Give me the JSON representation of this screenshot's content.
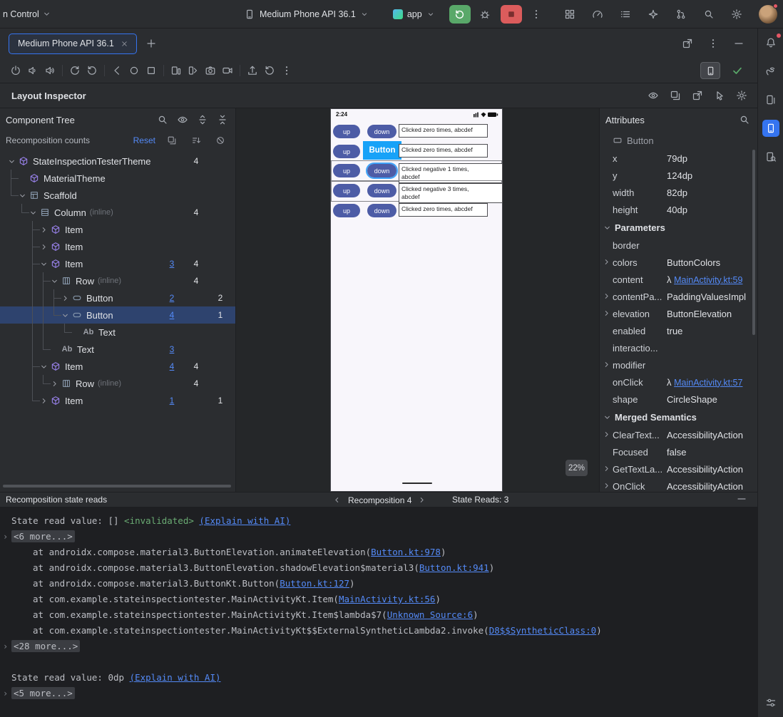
{
  "colors": {
    "accent": "#3574f0",
    "link": "#548af7",
    "selection": "#2e436e",
    "run_green": "#59a869",
    "stop_red": "#db5c5c",
    "device_button": "#4d5ca6",
    "overlay_blue": "#18a2f8",
    "invalidated_green": "#6aab73",
    "compose_node": "#9d85f2"
  },
  "icons": {
    "search-icon": "magnifier",
    "settings-icon": "gear",
    "notifications-icon": "bell",
    "visibility-icon": "eye",
    "close-icon": "x",
    "new-tab-icon": "plus",
    "more-icon": "kebab-dots",
    "rerun-icon": "circular-arrow",
    "debug-icon": "bug",
    "stop-icon": "red-square",
    "status-check-icon": "green-checkmark",
    "chevron-down-icon": "chevron-down",
    "chevron-right-icon": "chevron-right"
  },
  "titlebar": {
    "project_menu": "n Control",
    "device_selector": "Medium Phone API 36.1",
    "run_config": "app"
  },
  "tabbar": {
    "active_tab": "Medium Phone API 36.1"
  },
  "inspector": {
    "title": "Layout Inspector",
    "zoom": "22%"
  },
  "component_tree": {
    "title": "Component Tree",
    "counts_label": "Recomposition counts",
    "reset_label": "Reset",
    "nodes": [
      {
        "cells": "",
        "chev": "down",
        "icon": "compose",
        "label": "StateInspectionTesterTheme",
        "c": [
          "",
          "4",
          ""
        ]
      },
      {
        "cells": "t",
        "chev": "",
        "icon": "compose",
        "label": "MaterialTheme",
        "c": [
          "",
          "",
          ""
        ]
      },
      {
        "cells": "e",
        "chev": "down",
        "icon": "scaffold",
        "label": "Scaffold",
        "c": [
          "",
          "",
          ""
        ]
      },
      {
        "cells": "be",
        "chev": "down",
        "icon": "column",
        "label": "Column",
        "suffix": "(inline)",
        "c": [
          "",
          "4",
          ""
        ]
      },
      {
        "cells": "bbt",
        "chev": "right",
        "icon": "compose",
        "label": "Item",
        "c": [
          "",
          "",
          ""
        ]
      },
      {
        "cells": "bbt",
        "chev": "right",
        "icon": "compose",
        "label": "Item",
        "c": [
          "",
          "",
          ""
        ]
      },
      {
        "cells": "bbt",
        "chev": "down",
        "icon": "compose",
        "label": "Item",
        "c": [
          "3",
          "4",
          ""
        ]
      },
      {
        "cells": "bblt",
        "chev": "down",
        "icon": "row",
        "label": "Row",
        "suffix": "(inline)",
        "c": [
          "",
          "4",
          ""
        ]
      },
      {
        "cells": "bbllt",
        "chev": "right",
        "icon": "button",
        "label": "Button",
        "c": [
          "2",
          "",
          "2"
        ]
      },
      {
        "cells": "bblle",
        "chev": "down",
        "icon": "button",
        "label": "Button",
        "c": [
          "4",
          "",
          "1"
        ],
        "selected": true
      },
      {
        "cells": "bbllbe",
        "chev": "",
        "icon": "text",
        "label": "Text",
        "c": [
          "",
          "",
          ""
        ]
      },
      {
        "cells": "bble",
        "chev": "",
        "icon": "text",
        "label": "Text",
        "c": [
          "3",
          "",
          ""
        ]
      },
      {
        "cells": "bbt",
        "chev": "down",
        "icon": "compose",
        "label": "Item",
        "c": [
          "4",
          "4",
          ""
        ]
      },
      {
        "cells": "bble",
        "chev": "right",
        "icon": "row",
        "label": "Row",
        "suffix": "(inline)",
        "c": [
          "",
          "4",
          ""
        ]
      },
      {
        "cells": "bbe",
        "chev": "right",
        "icon": "compose",
        "label": "Item",
        "c": [
          "1",
          "",
          "1"
        ]
      }
    ]
  },
  "device": {
    "time": "2:24",
    "selection_label": "Button",
    "up_label": "up",
    "down_label": "down",
    "rows": [
      {
        "line1": "Clicked zero times, abcdef",
        "line2": "",
        "variant": "normal"
      },
      {
        "line1": "Clicked zero times, abcdef",
        "line2": "",
        "variant": "label"
      },
      {
        "line1": "Clicked negative 1 times,",
        "line2": "abcdef",
        "variant": "selected"
      },
      {
        "line1": "Clicked negative 3 times,",
        "line2": "abcdef",
        "variant": "normal"
      },
      {
        "line1": "Clicked zero times, abcdef",
        "line2": "",
        "variant": "normal"
      }
    ]
  },
  "attributes": {
    "title": "Attributes",
    "node_type": "Button",
    "geometry": [
      {
        "label": "x",
        "value": "79dp"
      },
      {
        "label": "y",
        "value": "124dp"
      },
      {
        "label": "width",
        "value": "82dp"
      },
      {
        "label": "height",
        "value": "40dp"
      }
    ],
    "sections": [
      {
        "title": "Parameters",
        "rows": [
          {
            "label": "border",
            "value": ""
          },
          {
            "label": "colors",
            "value": "ButtonColors",
            "expand": true
          },
          {
            "label": "content",
            "value": "MainActivity.kt:59",
            "lambda": true
          },
          {
            "label": "contentPa...",
            "value": "PaddingValuesImpl",
            "expand": true
          },
          {
            "label": "elevation",
            "value": "ButtonElevation",
            "expand": true
          },
          {
            "label": "enabled",
            "value": "true"
          },
          {
            "label": "interactio...",
            "value": ""
          },
          {
            "label": "modifier",
            "value": "",
            "expand": true
          },
          {
            "label": "onClick",
            "value": "MainActivity.kt:57",
            "lambda": true
          },
          {
            "label": "shape",
            "value": "CircleShape"
          }
        ]
      },
      {
        "title": "Merged Semantics",
        "rows": [
          {
            "label": "ClearText...",
            "value": "AccessibilityAction",
            "expand": true
          },
          {
            "label": "Focused",
            "value": "false"
          },
          {
            "label": "GetTextLa...",
            "value": "AccessibilityAction",
            "expand": true
          },
          {
            "label": "OnClick",
            "value": "AccessibilityAction",
            "expand": true
          }
        ]
      }
    ]
  },
  "state_reads": {
    "title": "Recomposition state reads",
    "nav_label": "Recomposition 4",
    "reads_label": "State Reads: 3",
    "lines": [
      {
        "type": "state",
        "text": "State read value: [] ",
        "invalidated": "<invalidated>",
        "link": "(Explain with AI)"
      },
      {
        "type": "fold",
        "text": "<6 more...>"
      },
      {
        "type": "frame",
        "pre": "at androidx.compose.material3.ButtonElevation.animateElevation(",
        "link": "Button.kt:978",
        "post": ")"
      },
      {
        "type": "frame",
        "pre": "at androidx.compose.material3.ButtonElevation.shadowElevation$material3(",
        "link": "Button.kt:941",
        "post": ")"
      },
      {
        "type": "frame",
        "pre": "at androidx.compose.material3.ButtonKt.Button(",
        "link": "Button.kt:127",
        "post": ")"
      },
      {
        "type": "frame",
        "pre": "at com.example.stateinspectiontester.MainActivityKt.Item(",
        "link": "MainActivity.kt:56",
        "post": ")"
      },
      {
        "type": "frame",
        "pre": "at com.example.stateinspectiontester.MainActivityKt.Item$lambda$7(",
        "link": "Unknown Source:6",
        "post": ")"
      },
      {
        "type": "frame",
        "pre": "at com.example.stateinspectiontester.MainActivityKt$$ExternalSyntheticLambda2.invoke(",
        "link": "D8$$SyntheticClass:0",
        "post": ")"
      },
      {
        "type": "fold",
        "text": "<28 more...>"
      },
      {
        "type": "blank"
      },
      {
        "type": "state",
        "text": "State read value: 0dp ",
        "invalidated": "",
        "link": "(Explain with AI)"
      },
      {
        "type": "fold",
        "text": "<5 more...>"
      }
    ]
  }
}
